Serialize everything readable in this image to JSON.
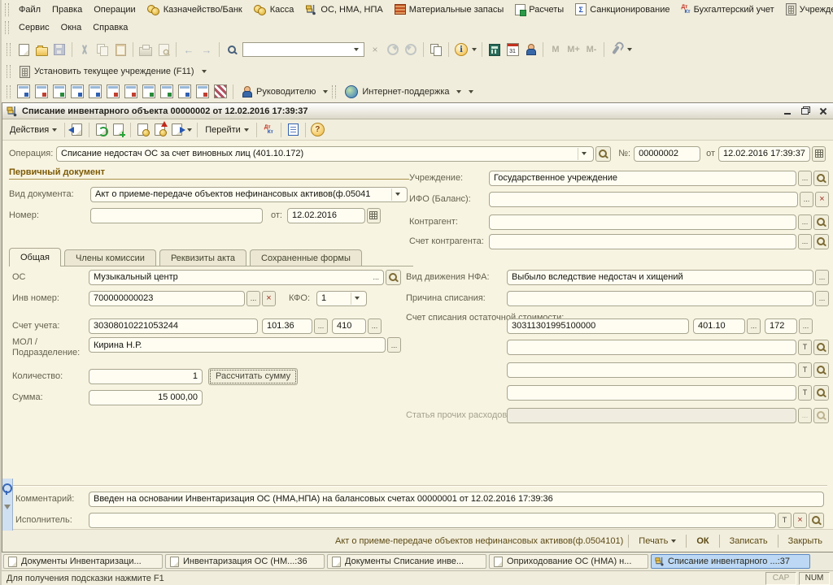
{
  "app": {
    "menu_row1": [
      "Файл",
      "Правка",
      "Операции",
      "Казначейство/Банк",
      "Касса",
      "ОС, НМА, НПА",
      "Материальные запасы",
      "Расчеты",
      "Санкционирование",
      "Бухгалтерский учет",
      "Учреждение"
    ],
    "menu_row2": [
      "Сервис",
      "Окна",
      "Справка"
    ],
    "set_institution": "Установить текущее учреждение (F11)",
    "manager_button": "Руководителю",
    "support_button": "Интернет-поддержка",
    "search_value": ""
  },
  "doc": {
    "title": "Списание инвентарного объекта 00000002 от 12.02.2016 17:39:37",
    "actions_button": "Действия",
    "goto_button": "Перейти",
    "operation": {
      "label": "Операция:",
      "value": "Списание недостач ОС за счет виновных лиц (401.10.172)",
      "no_label": "№:",
      "number": "00000002",
      "ot_label": "от",
      "datetime": "12.02.2016 17:39:37"
    },
    "primary": {
      "header": "Первичный документ",
      "doctype_label": "Вид документа:",
      "doctype": "Акт о приеме-передаче объектов нефинансовых активов(ф.05041",
      "number_label": "Номер:",
      "number": "",
      "ot_label": "от:",
      "date": "12.02.2016"
    },
    "org": {
      "institution_label": "Учреждение:",
      "institution": "Государственное учреждение",
      "ifo_label": "ИФО (Баланс):",
      "ifo": "",
      "contractor_label": "Контрагент:",
      "contractor": "",
      "contractor_account_label": "Счет контрагента:",
      "contractor_account": ""
    },
    "tabs": [
      "Общая",
      "Члены комиссии",
      "Реквизиты акта",
      "Сохраненные формы"
    ],
    "general": {
      "os_label": "ОС",
      "os": "Музыкальный центр",
      "inv_label": "Инв номер:",
      "inv": "700000000023",
      "kfo_label": "КФО:",
      "kfo": "1",
      "account_label": "Счет учета:",
      "account_code": "30308010221053244",
      "account": "101.36",
      "subkonto": "410",
      "mol_label": "МОЛ / Подразделение:",
      "mol": "Кирина Н.Р.",
      "qty_label": "Количество:",
      "qty": "1",
      "calc_button": "Рассчитать сумму",
      "sum_label": "Сумма:",
      "sum": "15 000,00",
      "movement_label": "Вид движения НФА:",
      "movement": "Выбыло вследствие недостач и хищений",
      "reason_label": "Причина списания:",
      "reason": "",
      "writeoff_label": "Счет списания остаточной стоимости:",
      "writeoff_code": "30311301995100000",
      "writeoff_account": "401.10",
      "writeoff_sub": "172",
      "extra1": "",
      "extra2": "",
      "extra3": "",
      "other_label": "Статья прочих расходов:",
      "other": ""
    },
    "comment_label": "Комментарий:",
    "comment": "Введен на основании Инвентаризация ОС (НМА,НПА) на балансовых счетах 00000001 от 12.02.2016 17:39:36",
    "executor_label": "Исполнитель:",
    "executor": "",
    "footer": {
      "form_name": "Акт о приеме-передаче объектов нефинансовых активов(ф.0504101)",
      "print": "Печать",
      "ok": "ОК",
      "save": "Записать",
      "close": "Закрыть"
    }
  },
  "taskbar": [
    "Документы Инвентаризаци...",
    "Инвентаризация ОС (НМ...:36",
    "Документы Списание инве...",
    "Оприходование ОС (НМА) н...",
    "Списание инвентарного ...:37"
  ],
  "status": {
    "hint": "Для получения подсказки нажмите F1",
    "cap": "CAP",
    "num": "NUM"
  },
  "glyphs": {
    "ellipsis": "...",
    "t": "T",
    "x": "×",
    "help": "?",
    "info": "i",
    "cal_day": "31",
    "m": "M",
    "m_plus": "M+",
    "m_minus": "M-",
    "dt": "Дт",
    "kt": "Кт"
  }
}
